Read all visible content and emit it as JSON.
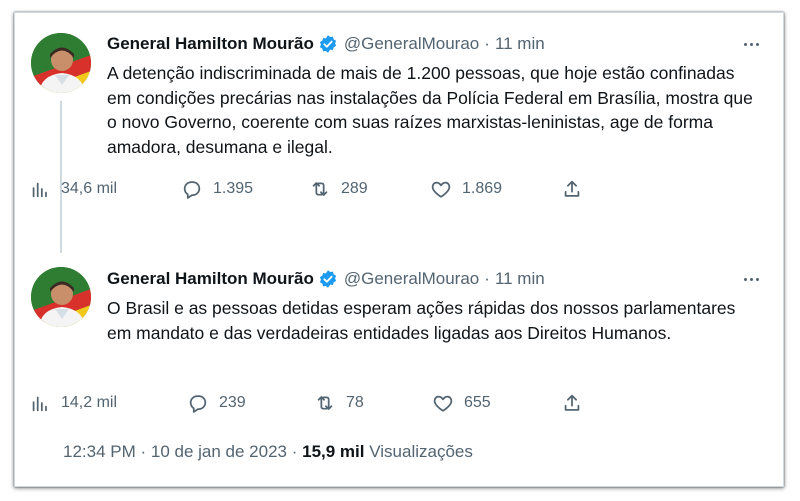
{
  "tweets": [
    {
      "author": {
        "name": "General Hamilton Mourão",
        "handle": "@GeneralMourao",
        "time": "11 min",
        "separator": "·"
      },
      "text": "A detenção indiscriminada de mais de 1.200 pessoas, que hoje estão confinadas em condições precárias nas instalações da Polícia Federal em Brasília, mostra que o novo Governo, coerente com suas raízes marxistas-leninistas, age de forma amadora, desumana e ilegal.",
      "stats": {
        "views": "34,6 mil",
        "replies": "1.395",
        "retweets": "289",
        "likes": "1.869"
      }
    },
    {
      "author": {
        "name": "General Hamilton Mourão",
        "handle": "@GeneralMourao",
        "time": "11 min",
        "separator": "·"
      },
      "text": "O Brasil e as pessoas detidas esperam ações rápidas dos nossos parlamentares em mandato e das verdadeiras entidades ligadas aos Direitos Humanos.",
      "stats": {
        "views": "14,2 mil",
        "replies": "239",
        "retweets": "78",
        "likes": "655"
      }
    }
  ],
  "footer": {
    "timestamp": "12:34 PM · 10 de jan de 2023 ·",
    "views_count": "15,9 mil",
    "views_label": "Visualizações"
  },
  "colors": {
    "text": "#0f1419",
    "secondary": "#536471",
    "verified": "#1d9bf0",
    "border": "#cfd9de"
  },
  "icons": [
    "verified-badge-icon",
    "more-options-icon",
    "views-icon",
    "reply-icon",
    "retweet-icon",
    "like-icon",
    "share-icon"
  ]
}
